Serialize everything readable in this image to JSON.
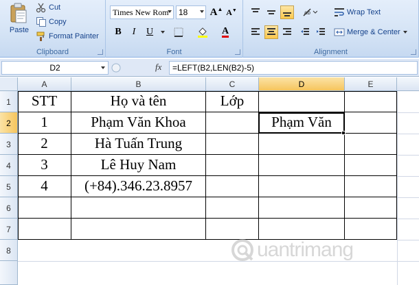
{
  "ribbon": {
    "clipboard": {
      "group_label": "Clipboard",
      "paste_label": "Paste",
      "cut_label": "Cut",
      "copy_label": "Copy",
      "format_painter_label": "Format Painter"
    },
    "font": {
      "group_label": "Font",
      "font_name": "Times New Rom",
      "font_size": "18",
      "bold": "B",
      "italic": "I",
      "underline": "U",
      "font_color_glyph": "A"
    },
    "alignment": {
      "group_label": "Alignment",
      "wrap_text_label": "Wrap Text",
      "merge_center_label": "Merge & Center"
    }
  },
  "formula_bar": {
    "name_box": "D2",
    "fx_label": "fx",
    "formula": "=LEFT(B2,LEN(B2)-5)"
  },
  "sheet": {
    "columns": [
      "A",
      "B",
      "C",
      "D",
      "E"
    ],
    "rows": [
      "1",
      "2",
      "3",
      "4",
      "5",
      "6",
      "7",
      "8"
    ],
    "active_cell": "D2",
    "cells": {
      "A1": "STT",
      "B1": "Họ và tên",
      "C1": "Lớp",
      "A2": "1",
      "B2": "Phạm Văn Khoa",
      "D2": "Phạm Văn",
      "A3": "2",
      "B3": "Hà Tuấn Trung",
      "A4": "3",
      "B4": "Lê Huy Nam",
      "A5": "4",
      "B5": "(+84).346.23.8957"
    }
  },
  "watermark": {
    "text": "uantrimang"
  },
  "colors": {
    "ribbon_bg": "#d4e3f5",
    "header_active": "#f6c55d",
    "grid_line": "#d0d7e5"
  }
}
